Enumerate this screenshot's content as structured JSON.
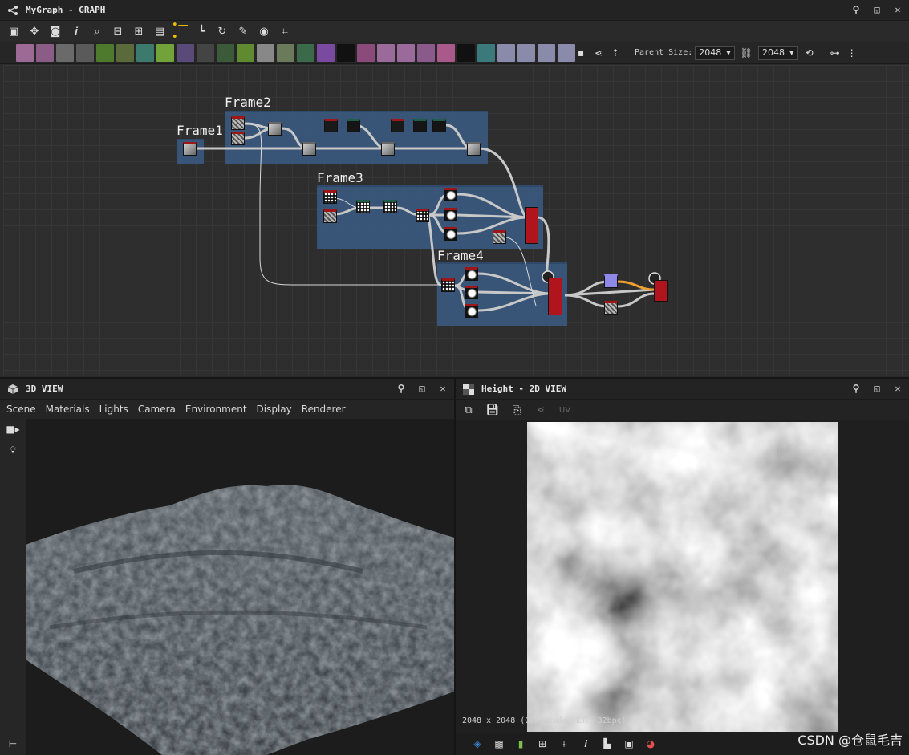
{
  "graph": {
    "title": "MyGraph - GRAPH",
    "parent_size_label": "Parent Size:",
    "parent_size_w": "2048",
    "parent_size_h": "2048",
    "frames": [
      "Frame1",
      "Frame2",
      "Frame3",
      "Frame4"
    ]
  },
  "view3d": {
    "title": "3D VIEW",
    "menu": [
      "Scene",
      "Materials",
      "Lights",
      "Camera",
      "Environment",
      "Display",
      "Renderer"
    ]
  },
  "view2d": {
    "title": "Height - 2D VIEW",
    "resolution_info": "2048 x 2048 (Grayscale HDR, 32bpc)",
    "watermark": "CSDN @仓鼠毛吉"
  },
  "colors": {
    "frame": "#3a5a80",
    "output_node": "#b0141c",
    "orange_link": "#f0a030"
  }
}
